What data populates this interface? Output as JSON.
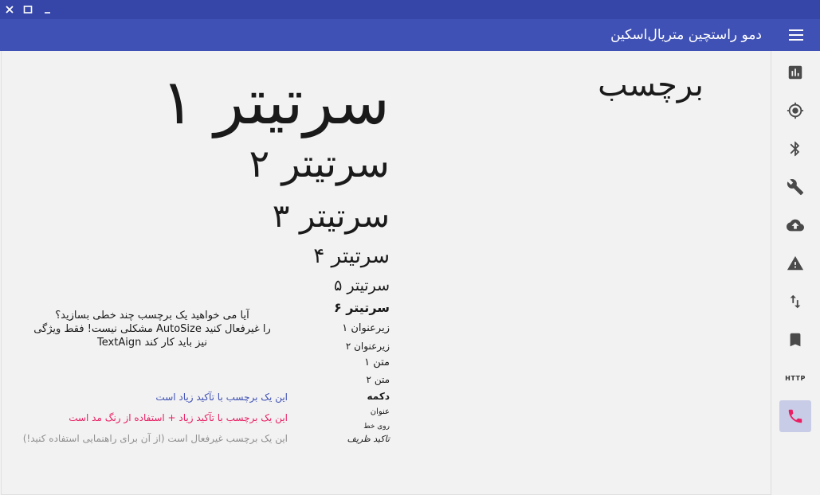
{
  "window": {
    "close_icon": "close-icon",
    "maximize_icon": "maximize-icon",
    "minimize_icon": "minimize-icon"
  },
  "appbar": {
    "title": "دمو راستچین متریال‌اسکین",
    "menu_icon": "hamburger-menu-icon",
    "background": "#3f51b5",
    "titlebar_background": "#3546a8"
  },
  "labels": {
    "heading": "برچسب",
    "h1": "سرتیتر ۱",
    "h2": "سرتیتر ۲",
    "h3": "سرتیتر ۳",
    "h4": "سرتیتر ۴",
    "h5": "سرتیتر ۵",
    "h6": "سرتیتر ۶",
    "subtitle1": "زیرعنوان ۱",
    "subtitle2": "زیرعنوان ۲",
    "body1": "متن ۱",
    "body2": "متن ۲",
    "button": "دکمه",
    "caption": "عنوان",
    "overline": "روی خط",
    "emphasis": "تاکید ظریف"
  },
  "multiline": {
    "line1": "آیا می خواهید یک برچسب چند خطی بسازید؟",
    "line2": "را غیرفعال کنید AutoSize مشکلی نیست! فقط ویژگی",
    "line3": "نیز باید کار کند TextAign"
  },
  "highlights": {
    "accent": "این یک برچسب با تآکید زیاد است",
    "pink": "این یک برچسب با تآکید زیاد + استفاده از رنگ مد است",
    "disabled": "این یک برچسب غیرفعال است (از آن برای راهنمایی استفاده کنید!)",
    "accent_color": "#3f51b5",
    "pink_color": "#e91e63",
    "disabled_color": "#8f8f8f"
  },
  "rail": {
    "items": [
      {
        "icon": "bar-chart-icon"
      },
      {
        "icon": "gps-target-icon"
      },
      {
        "icon": "bluetooth-icon"
      },
      {
        "icon": "wrench-icon"
      },
      {
        "icon": "cloud-upload-icon"
      },
      {
        "icon": "warning-icon"
      },
      {
        "icon": "swap-vertical-icon"
      },
      {
        "icon": "bookmark-icon"
      },
      {
        "icon": "http-icon",
        "label": "HTTP"
      },
      {
        "icon": "phone-icon",
        "active": true
      }
    ],
    "active_background": "#c9cce6"
  }
}
